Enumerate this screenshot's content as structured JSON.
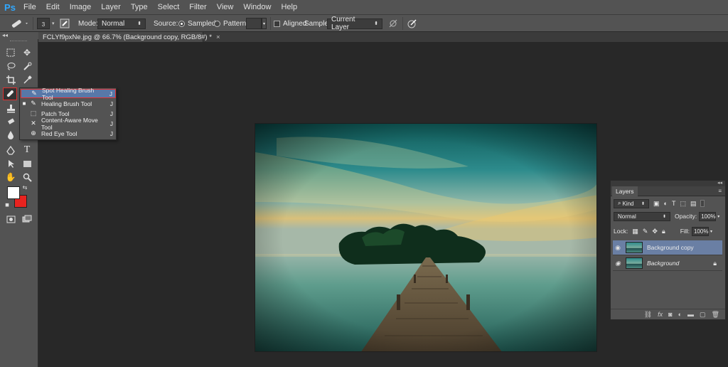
{
  "app": {
    "logo": "Ps"
  },
  "menu": [
    "File",
    "Edit",
    "Image",
    "Layer",
    "Type",
    "Select",
    "Filter",
    "View",
    "Window",
    "Help"
  ],
  "options": {
    "brush_size": "3",
    "mode_label": "Mode:",
    "mode_value": "Normal",
    "source_label": "Source:",
    "source_sampled": "Sampled",
    "source_pattern": "Pattern:",
    "aligned_label": "Aligned",
    "sample_label": "Sample:",
    "sample_value": "Current Layer"
  },
  "document_tab": {
    "title": "FCLYf9pxNe.jpg @ 66.7% (Background copy, RGB/8#) *",
    "close": "×"
  },
  "toolbar": {
    "collapse": "◂◂"
  },
  "flyout": {
    "items": [
      {
        "label": "Spot Healing Brush Tool",
        "key": "J",
        "selected": true,
        "current": false
      },
      {
        "label": "Healing Brush Tool",
        "key": "J",
        "selected": false,
        "current": true
      },
      {
        "label": "Patch Tool",
        "key": "J",
        "selected": false,
        "current": false
      },
      {
        "label": "Content-Aware Move Tool",
        "key": "J",
        "selected": false,
        "current": false
      },
      {
        "label": "Red Eye Tool",
        "key": "J",
        "selected": false,
        "current": false
      }
    ]
  },
  "layers_panel": {
    "collapse": "◂◂",
    "tab_label": "Layers",
    "filter_value": "Kind",
    "blend_mode": "Normal",
    "opacity_label": "Opacity:",
    "opacity_value": "100%",
    "lock_label": "Lock:",
    "fill_label": "Fill:",
    "fill_value": "100%",
    "layers": [
      {
        "name": "Background copy",
        "selected": true
      },
      {
        "name": "Background",
        "selected": false
      }
    ]
  },
  "colors": {
    "foreground": "#ffffff",
    "background": "#e8231f",
    "accent": "#31a8ff"
  }
}
